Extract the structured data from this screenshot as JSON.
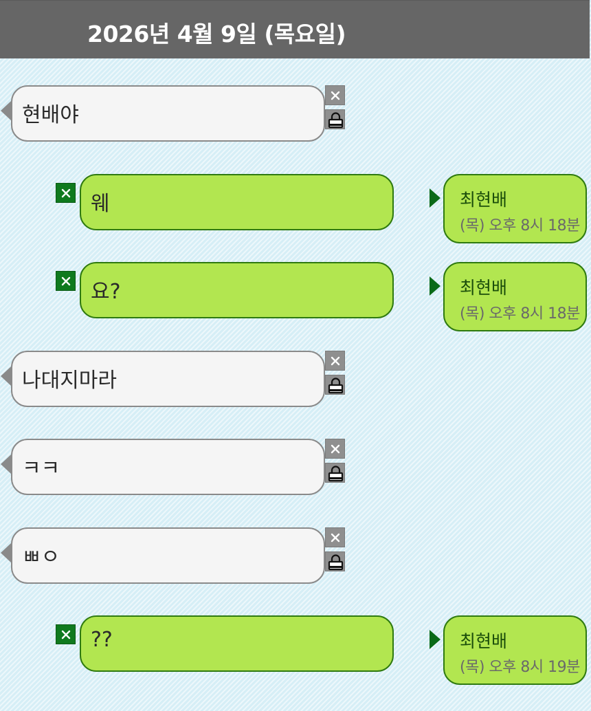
{
  "header": {
    "date": "2026년 4월 9일 (목요일)"
  },
  "messages": [
    {
      "side": "in",
      "text": "현배야"
    },
    {
      "side": "out",
      "text": "웨",
      "sender": "최현배",
      "time": "(목) 오후 8시 18분"
    },
    {
      "side": "out",
      "text": "요?",
      "sender": "최현배",
      "time": "(목) 오후 8시 18분"
    },
    {
      "side": "in",
      "text": "나대지마라"
    },
    {
      "side": "in",
      "text": "ㅋㅋ"
    },
    {
      "side": "in",
      "text": "ㅃㅇ"
    },
    {
      "side": "out",
      "text": "??",
      "sender": "최현배",
      "time": "(목) 오후 8시 19분"
    }
  ],
  "icons": {
    "delete": "close-icon",
    "lock": "lock-icon"
  },
  "colors": {
    "header_bg": "#666666",
    "incoming_bubble": "#f5f5f5",
    "outgoing_bubble": "#b2e650",
    "outgoing_border": "#2f7a10",
    "delete_green": "#0f7a1e",
    "page_bg": "#d6eef6"
  }
}
